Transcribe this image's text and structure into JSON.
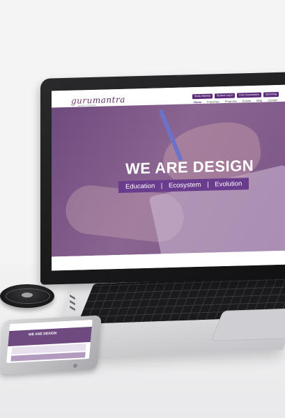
{
  "site": {
    "logo_prefix": "guru",
    "logo_suffix": "mantra",
    "logo_tagline": "gurukul consultants",
    "top_buttons": [
      "Study Material",
      "Student Log In",
      "Free Consultation",
      "Upcoming"
    ],
    "nav_items": [
      "Home",
      "Franchise",
      "Programs",
      "Events",
      "Blog",
      "Contact"
    ],
    "active_nav": "Home",
    "hero_title": "WE ARE DESIGN",
    "hero_tags": [
      "Education",
      "Ecosystem",
      "Evolution"
    ],
    "hero_separator": "|"
  },
  "phone": {
    "hero_title": "WE ARE DESIGN"
  },
  "colors": {
    "brand_purple": "#5b2b7a",
    "hero_overlay": "#7a5686",
    "tag_bar": "#6a3c8e"
  }
}
